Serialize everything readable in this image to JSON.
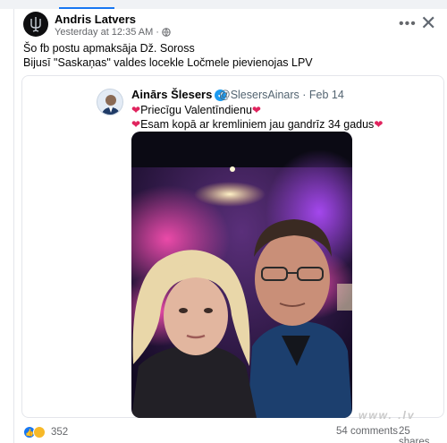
{
  "post": {
    "author": "Andris Latvers",
    "timestamp": "Yesterday at 12:35 AM",
    "audience_icon": "globe-icon",
    "lines": [
      "Šo fb postu apmaksāja Dž. Soross",
      "Bijusī \"Saskaņas\" valdes locekle Ločmele pievienojas LPV"
    ]
  },
  "embed": {
    "name": "Ainārs Šlesers",
    "handle": "@SlesersAinars · Feb 14",
    "line1": "Priecīgu Valentīndienu",
    "line2": "Esam kopā ar kremliniem jau gandrīz 34 gadus"
  },
  "footer": {
    "reaction_count": "352",
    "comments": "54 comments",
    "shares": "25 shares"
  },
  "watermark": "www.     .lv",
  "colors": {
    "accent": "#1877f2",
    "heart": "#e0245e",
    "verified": "#1d9bf0"
  }
}
